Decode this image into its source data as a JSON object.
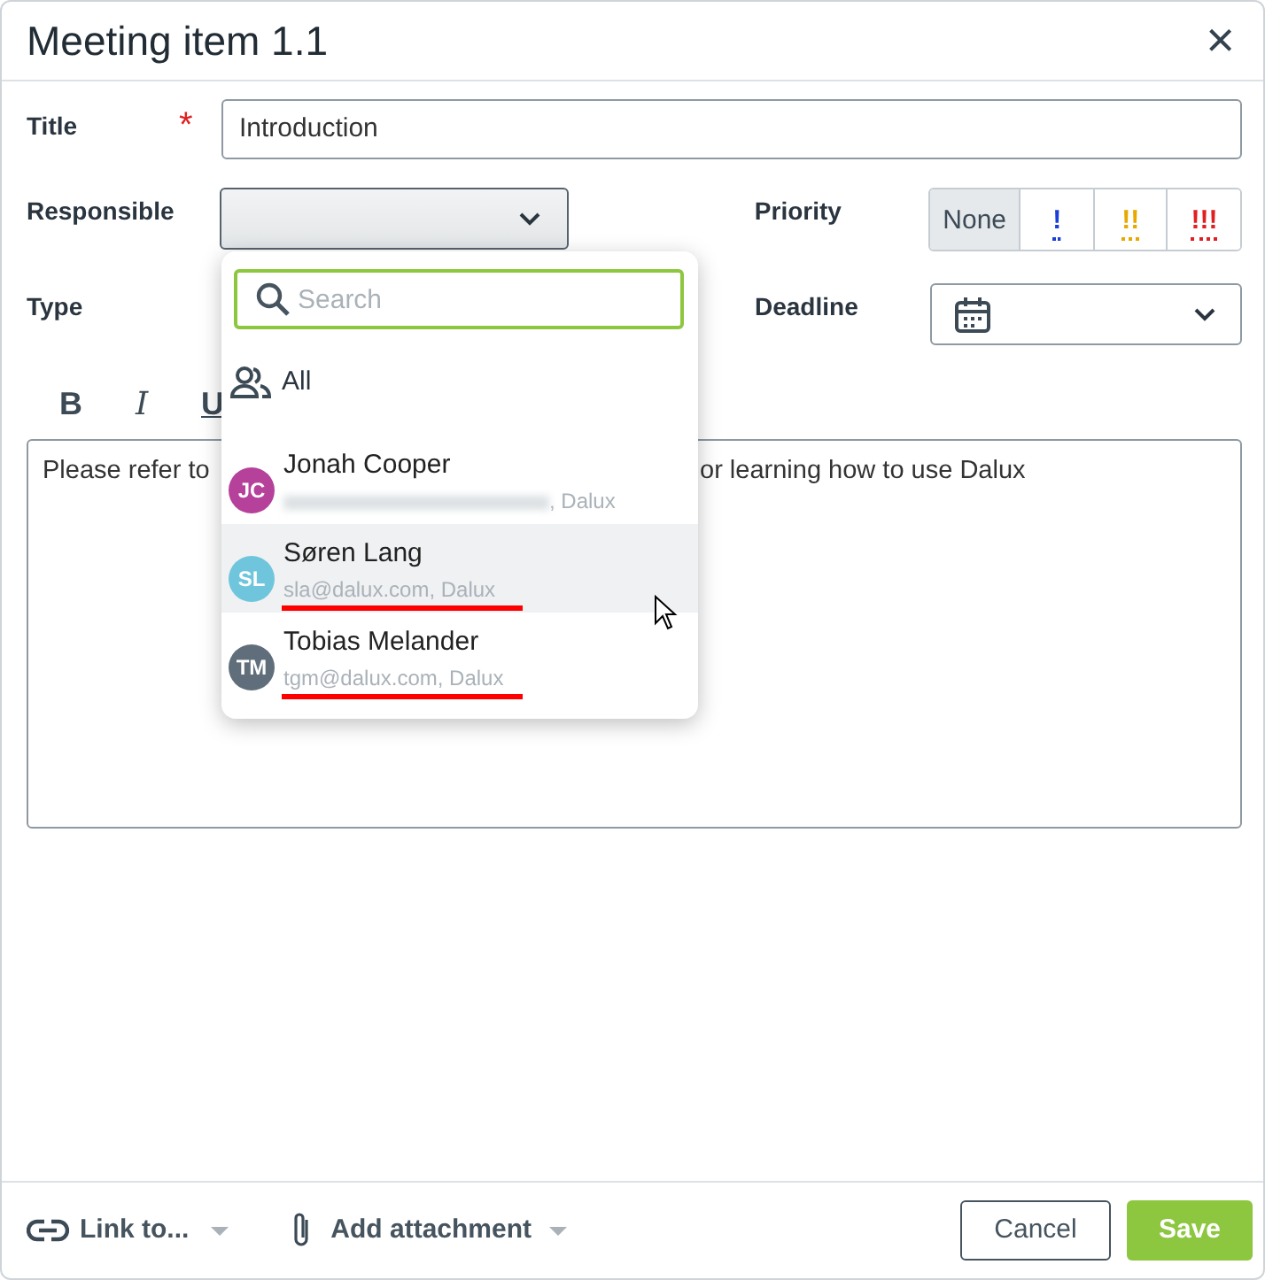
{
  "dialog": {
    "title": "Meeting item 1.1",
    "close": "×"
  },
  "form": {
    "title": {
      "label": "Title",
      "required_mark": "*",
      "value": "Introduction"
    },
    "responsible": {
      "label": "Responsible"
    },
    "priority": {
      "label": "Priority",
      "options": [
        {
          "label": "None",
          "selected": true,
          "color": "#3c4a56"
        },
        {
          "label": "!",
          "selected": false,
          "color": "#1a3fd8"
        },
        {
          "label": "!!",
          "selected": false,
          "color": "#e8a800"
        },
        {
          "label": "!!!",
          "selected": false,
          "color": "#e02020"
        }
      ]
    },
    "type": {
      "label": "Type"
    },
    "deadline": {
      "label": "Deadline"
    }
  },
  "editor": {
    "toolbar": [
      {
        "label": "B",
        "kind": "bold"
      },
      {
        "label": "I",
        "kind": "italic"
      },
      {
        "label": "U",
        "kind": "underline"
      }
    ],
    "text_parts": [
      "Please refer to",
      "or learning how to use Dalux"
    ]
  },
  "dropdown": {
    "search_placeholder": "Search",
    "all_label": "All",
    "people": [
      {
        "initials": "JC",
        "name": "Jonah Cooper",
        "email": ", Dalux",
        "redacted": true,
        "color": "#b5419b",
        "hovered": false,
        "underlined": false
      },
      {
        "initials": "SL",
        "name": "Søren Lang",
        "email": "sla@dalux.com, Dalux",
        "redacted": false,
        "color": "#6fc6dc",
        "hovered": true,
        "underlined": true
      },
      {
        "initials": "TM",
        "name": "Tobias Melander",
        "email": "tgm@dalux.com, Dalux",
        "redacted": false,
        "color": "#5f6e7a",
        "hovered": false,
        "underlined": true
      }
    ]
  },
  "footer": {
    "link": "Link to...",
    "attachment": "Add attachment",
    "cancel": "Cancel",
    "save": "Save"
  }
}
